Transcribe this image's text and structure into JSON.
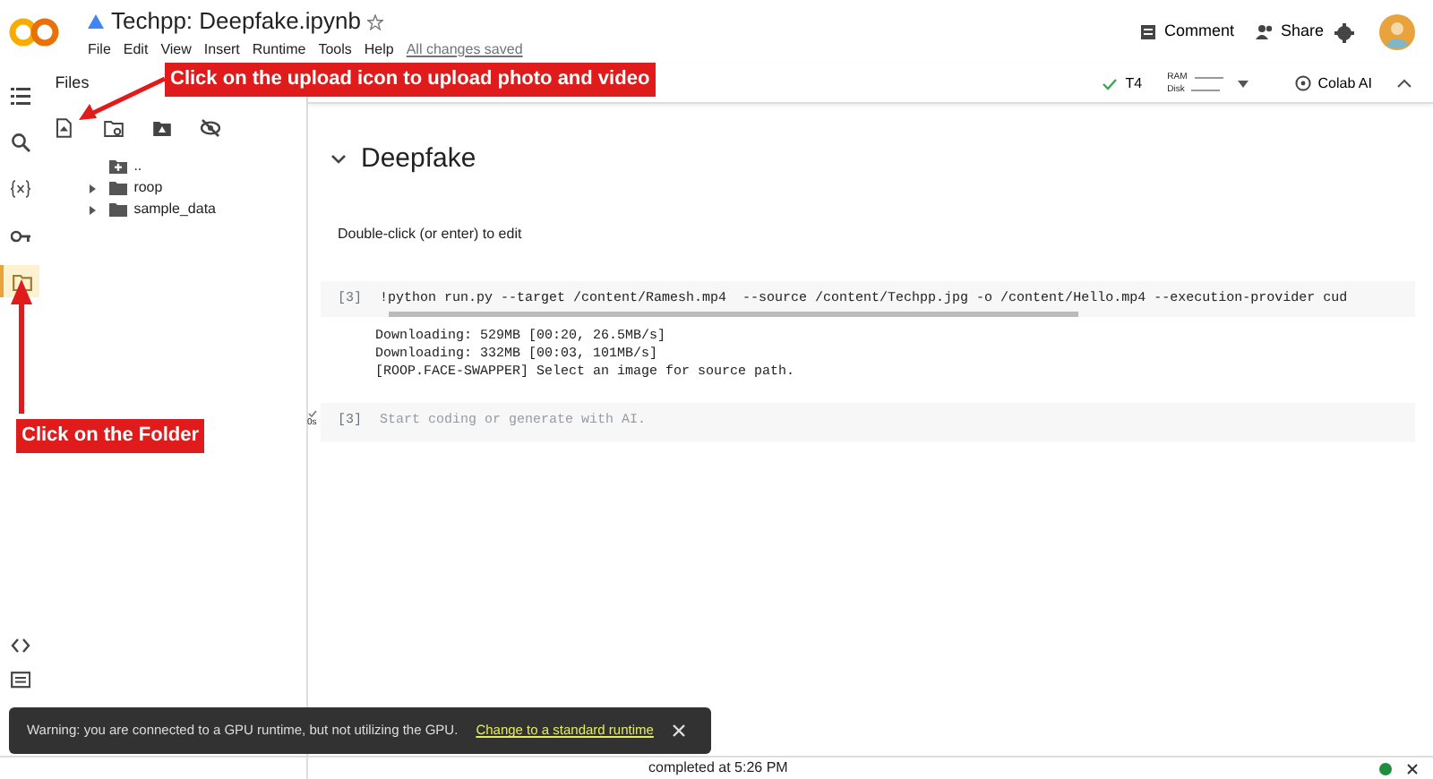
{
  "app": {
    "title": "Techpp: Deepfake.ipynb",
    "menu": [
      "File",
      "Edit",
      "View",
      "Insert",
      "Runtime",
      "Tools",
      "Help"
    ],
    "save_status": "All changes saved",
    "actions": [
      {
        "kind": "comment",
        "label": "Comment"
      },
      {
        "kind": "share",
        "label": "Share"
      }
    ]
  },
  "runtime": {
    "accelerator": "T4",
    "ram_label": "RAM",
    "disk_label": "Disk",
    "ai_button": "Colab AI"
  },
  "side_rail": [
    {
      "kind": "toc",
      "selected": false
    },
    {
      "kind": "search",
      "selected": false
    },
    {
      "kind": "variables",
      "selected": false
    },
    {
      "kind": "secrets",
      "selected": false
    },
    {
      "kind": "files",
      "selected": true
    }
  ],
  "side_rail_bottom": [
    {
      "kind": "code"
    },
    {
      "kind": "terminal"
    }
  ],
  "files_panel": {
    "title": "Files",
    "tree": [
      {
        "name": "..",
        "kind": "parent"
      },
      {
        "name": "roop",
        "kind": "folder",
        "expanded": false
      },
      {
        "name": "sample_data",
        "kind": "folder",
        "expanded": false
      }
    ]
  },
  "notebook": {
    "section": {
      "title": "Deepfake",
      "expanded": true
    },
    "text_hint": "Double-click (or enter) to edit",
    "cells": [
      {
        "kind": "code",
        "count": "[3]",
        "source": "!python run.py --target /content/Ramesh.mp4  --source /content/Techpp.jpg -o /content/Hello.mp4 --execution-provider cud",
        "output": [
          "Downloading: 529MB [00:20, 26.5MB/s]",
          "Downloading: 332MB [00:03, 101MB/s]",
          "[ROOP.FACE-SWAPPER] Select an image for source path."
        ]
      },
      {
        "kind": "empty",
        "count": "[3]",
        "placeholder": "Start coding or generate with AI.",
        "run_time": "0s"
      }
    ]
  },
  "toast": {
    "message": "Warning: you are connected to a GPU runtime, but not utilizing the GPU.",
    "link": "Change to a standard runtime"
  },
  "status_bar": {
    "text": "completed at 5:26 PM"
  },
  "annotations": [
    {
      "kind": "upload",
      "text": "Click on the upload icon to upload photo and video"
    },
    {
      "kind": "folder",
      "text": "Click on the Folder"
    }
  ]
}
